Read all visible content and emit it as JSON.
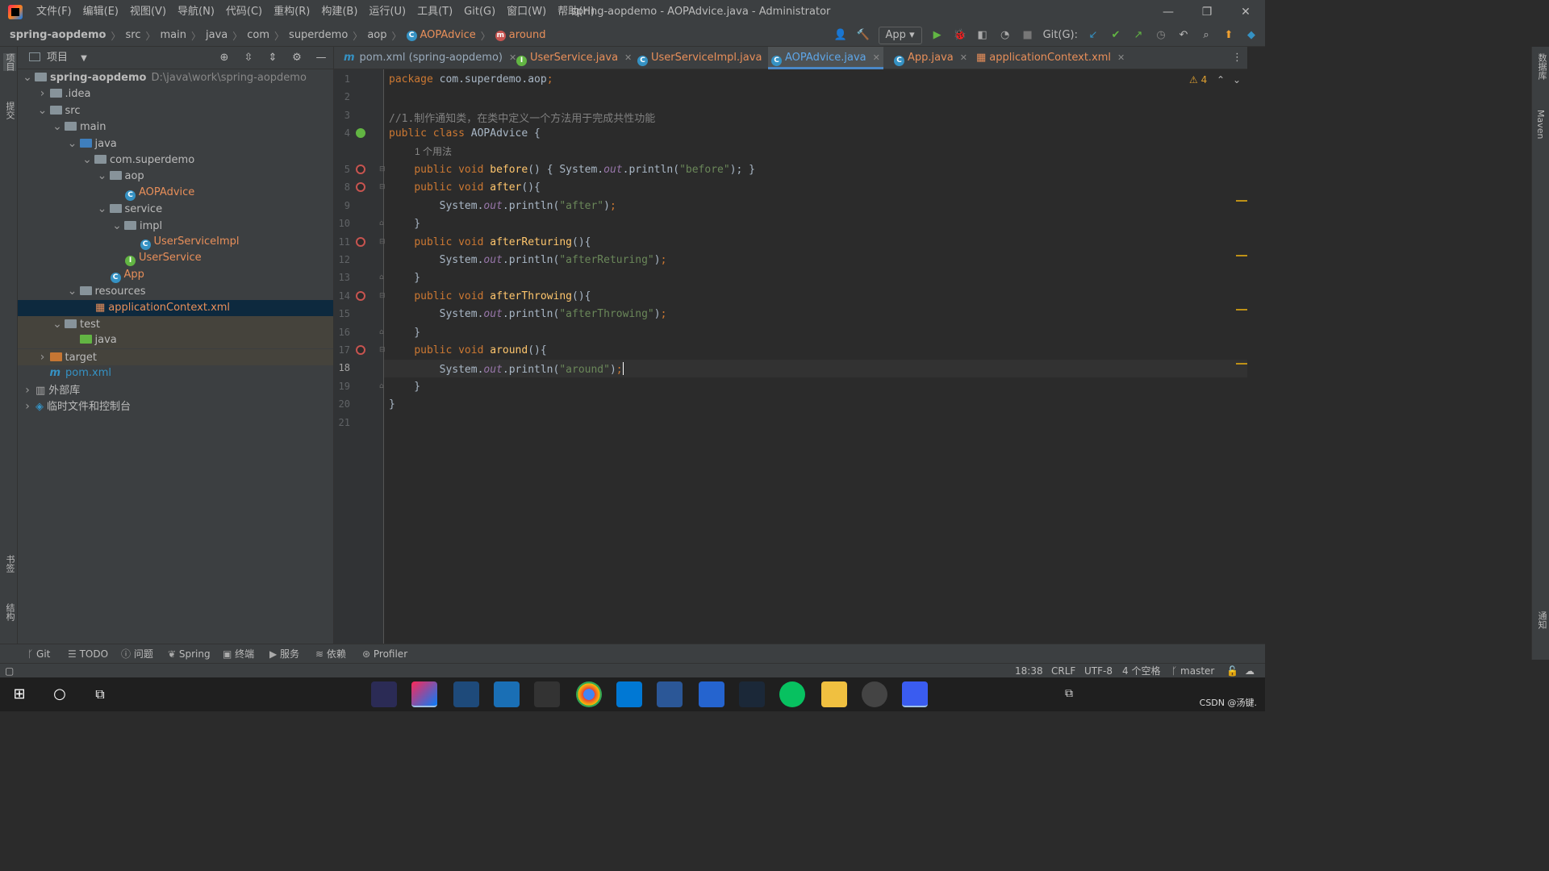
{
  "window": {
    "title": "spring-aopdemo - AOPAdvice.java - Administrator",
    "minimize": "—",
    "restore": "❐",
    "close": "✕"
  },
  "menu": [
    "文件(F)",
    "编辑(E)",
    "视图(V)",
    "导航(N)",
    "代码(C)",
    "重构(R)",
    "构建(B)",
    "运行(U)",
    "工具(T)",
    "Git(G)",
    "窗口(W)",
    "帮助(H)"
  ],
  "breadcrumb": {
    "items": [
      "spring-aopdemo",
      "src",
      "main",
      "java",
      "com",
      "superdemo",
      "aop"
    ],
    "class_name": "AOPAdvice",
    "method_name": "around"
  },
  "toolbar": {
    "run_config": "App",
    "git_label": "Git(G):"
  },
  "project": {
    "title": "项目",
    "tree": [
      {
        "label": "spring-aopdemo",
        "path": "D:\\java\\work\\spring-aopdemo",
        "depth": 0,
        "expanded": true,
        "icon": "module-folder"
      },
      {
        "label": ".idea",
        "depth": 1,
        "expanded": false,
        "icon": "folder"
      },
      {
        "label": "src",
        "depth": 1,
        "expanded": true,
        "icon": "folder"
      },
      {
        "label": "main",
        "depth": 2,
        "expanded": true,
        "icon": "folder"
      },
      {
        "label": "java",
        "depth": 3,
        "expanded": true,
        "icon": "source-folder"
      },
      {
        "label": "com.superdemo",
        "depth": 4,
        "expanded": true,
        "icon": "package"
      },
      {
        "label": "aop",
        "depth": 5,
        "expanded": true,
        "icon": "package"
      },
      {
        "label": "AOPAdvice",
        "depth": 6,
        "icon": "class"
      },
      {
        "label": "service",
        "depth": 5,
        "expanded": true,
        "icon": "package"
      },
      {
        "label": "impl",
        "depth": 6,
        "expanded": true,
        "icon": "package"
      },
      {
        "label": "UserServiceImpl",
        "depth": 7,
        "icon": "class"
      },
      {
        "label": "UserService",
        "depth": 6,
        "icon": "interface"
      },
      {
        "label": "App",
        "depth": 5,
        "icon": "class"
      },
      {
        "label": "resources",
        "depth": 3,
        "expanded": true,
        "icon": "resources-folder"
      },
      {
        "label": "applicationContext.xml",
        "depth": 4,
        "icon": "xml",
        "selected": true
      },
      {
        "label": "test",
        "depth": 2,
        "expanded": true,
        "icon": "folder"
      },
      {
        "label": "java",
        "depth": 3,
        "icon": "test-folder"
      },
      {
        "label": "target",
        "depth": 1,
        "expanded": false,
        "icon": "excluded-folder"
      },
      {
        "label": "pom.xml",
        "depth": 1,
        "icon": "maven"
      },
      {
        "label": "外部库",
        "depth": 0,
        "expanded": false,
        "icon": "library"
      },
      {
        "label": "临时文件和控制台",
        "depth": 0,
        "expanded": false,
        "icon": "scratch"
      }
    ]
  },
  "tabs": [
    {
      "label": "pom.xml (spring-aopdemo)",
      "icon": "maven"
    },
    {
      "label": "UserService.java",
      "icon": "interface"
    },
    {
      "label": "UserServiceImpl.java",
      "icon": "class"
    },
    {
      "label": "AOPAdvice.java",
      "icon": "class",
      "active": true
    },
    {
      "label": "App.java",
      "icon": "class"
    },
    {
      "label": "applicationContext.xml",
      "icon": "xml"
    }
  ],
  "editor": {
    "warnings": "4",
    "usage_hint": "1 个用法",
    "lines": [
      {
        "n": "1",
        "code": "package com.superdemo.aop;"
      },
      {
        "n": "2",
        "code": ""
      },
      {
        "n": "3",
        "code": "//1.制作通知类，在类中定义一个方法用于完成共性功能"
      },
      {
        "n": "4",
        "code": "public class AOPAdvice {"
      },
      {
        "n": "5",
        "code": "    public void before() { System.out.println(\"before\"); }"
      },
      {
        "n": "8",
        "code": "    public void after(){"
      },
      {
        "n": "9",
        "code": "        System.out.println(\"after\");"
      },
      {
        "n": "10",
        "code": "    }"
      },
      {
        "n": "11",
        "code": "    public void afterReturing(){"
      },
      {
        "n": "12",
        "code": "        System.out.println(\"afterReturing\");"
      },
      {
        "n": "13",
        "code": "    }"
      },
      {
        "n": "14",
        "code": "    public void afterThrowing(){"
      },
      {
        "n": "15",
        "code": "        System.out.println(\"afterThrowing\");"
      },
      {
        "n": "16",
        "code": "    }"
      },
      {
        "n": "17",
        "code": "    public void around(){"
      },
      {
        "n": "18",
        "code": "        System.out.println(\"around\");"
      },
      {
        "n": "19",
        "code": "    }"
      },
      {
        "n": "20",
        "code": "}"
      },
      {
        "n": "21",
        "code": ""
      }
    ]
  },
  "bottom_tools": [
    "Git",
    "TODO",
    "问题",
    "Spring",
    "终端",
    "服务",
    "依赖",
    "Profiler"
  ],
  "left_strip": [
    "项目",
    "提交",
    "书签",
    "结构"
  ],
  "right_strip": [
    "数据库",
    "Maven",
    "通知"
  ],
  "status": {
    "position": "18:38",
    "line_sep": "CRLF",
    "encoding": "UTF-8",
    "indent": "4 个空格",
    "branch": "master"
  },
  "taskbar": {
    "watermark": "CSDN @汤键."
  },
  "colors": {
    "keyword": "#cc7832",
    "string": "#6a8759",
    "method": "#ffc66d",
    "comment": "#808080",
    "static_field": "#9876aa",
    "class_icon": "#3592c4",
    "selection": "#0d293e"
  }
}
